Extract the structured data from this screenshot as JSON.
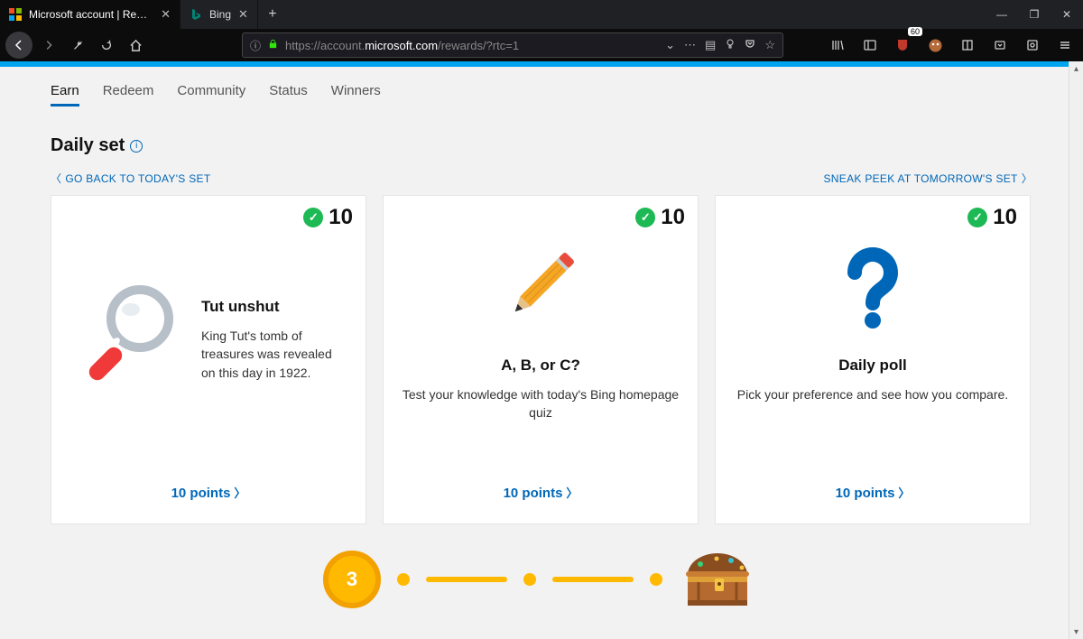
{
  "browser": {
    "tabs": [
      {
        "title": "Microsoft account | Rewards D...",
        "active": true
      },
      {
        "title": "Bing",
        "active": false
      }
    ],
    "url_prefix": "https://account.",
    "url_domain": "microsoft.com",
    "url_path": "/rewards/?rtc=1",
    "ext_badge": "60"
  },
  "nav": {
    "items": [
      {
        "label": "Earn",
        "active": true
      },
      {
        "label": "Redeem"
      },
      {
        "label": "Community"
      },
      {
        "label": "Status"
      },
      {
        "label": "Winners"
      }
    ]
  },
  "section": {
    "title": "Daily set"
  },
  "setnav": {
    "back": "GO BACK TO TODAY'S SET",
    "forward": "SNEAK PEEK AT TOMORROW'S SET"
  },
  "cards": [
    {
      "points_top": "10",
      "title": "Tut unshut",
      "desc": "King Tut's tomb of treasures was revealed on this day in 1922.",
      "footer": "10 points"
    },
    {
      "points_top": "10",
      "title": "A, B, or C?",
      "desc": "Test your knowledge with today's Bing homepage quiz",
      "footer": "10 points"
    },
    {
      "points_top": "10",
      "title": "Daily poll",
      "desc": "Pick your preference and see how you compare.",
      "footer": "10 points"
    }
  ],
  "streak": {
    "count": "3"
  }
}
